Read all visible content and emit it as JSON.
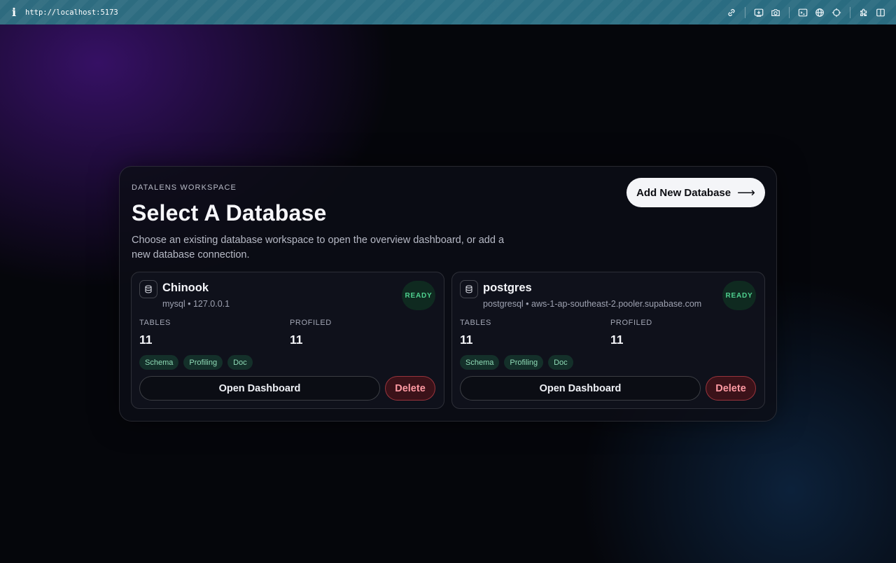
{
  "toolbar": {
    "info_glyph": "i",
    "url": "http://localhost:5173",
    "icons": [
      "link-icon",
      "screen-capture-icon",
      "camera-icon",
      "terminal-icon",
      "globe-icon",
      "crosshair-icon",
      "extension-icon",
      "sidebar-icon"
    ]
  },
  "header": {
    "eyebrow": "DATALENS WORKSPACE",
    "title": "Select A Database",
    "subtitle": "Choose an existing database workspace to open the overview dashboard, or add a new database connection.",
    "add_button_label": "Add New Database",
    "add_button_arrow": "⟶"
  },
  "labels": {
    "tables": "TABLES",
    "profiled": "PROFILED"
  },
  "databases": [
    {
      "name": "Chinook",
      "meta": "mysql • 127.0.0.1",
      "status": "READY",
      "tables": "11",
      "profiled": "11",
      "tags": [
        "Schema",
        "Profiling",
        "Doc"
      ],
      "open_label": "Open Dashboard",
      "delete_label": "Delete"
    },
    {
      "name": "postgres",
      "meta": "postgresql • aws-1-ap-southeast-2.pooler.supabase.com",
      "status": "READY",
      "tables": "11",
      "profiled": "11",
      "tags": [
        "Schema",
        "Profiling",
        "Doc"
      ],
      "open_label": "Open Dashboard",
      "delete_label": "Delete"
    }
  ],
  "colors": {
    "status_ready": "#4fd08f",
    "delete_text": "#ff9aa3",
    "tag_text": "#8fdcb6",
    "toolbar_bg": "#2b6f84"
  }
}
